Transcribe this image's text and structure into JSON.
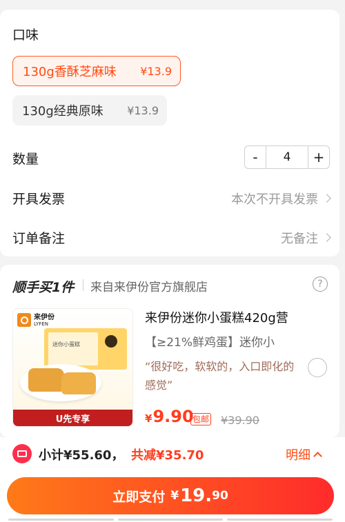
{
  "flavor": {
    "label": "口味",
    "options": [
      {
        "name": "130g香酥芝麻味",
        "price": "¥13.9",
        "selected": true
      },
      {
        "name": "130g经典原味",
        "price": "¥13.9",
        "selected": false
      }
    ]
  },
  "quantity": {
    "label": "数量",
    "minus": "-",
    "value": "4",
    "plus": "+"
  },
  "invoice": {
    "label": "开具发票",
    "value": "本次不开具发票"
  },
  "remark": {
    "label": "订单备注",
    "value": "无备注"
  },
  "addon": {
    "title": "顺手买1件",
    "from": "来自来伊份官方旗舰店",
    "help_icon": "?",
    "product": {
      "brand_cn": "来伊份",
      "brand_en": "LYFEN",
      "box_label": "迷你小蛋糕",
      "banner": "U先专享",
      "title": "来伊份迷你小蛋糕420g营",
      "subtitle": "【≥21%鲜鸡蛋】迷你小",
      "quote": "“很好吃，软软的，入口即化的感觉”",
      "price_symbol": "¥",
      "price": "9.90",
      "tag": "包邮",
      "old_price": "¥39.90"
    }
  },
  "footer": {
    "subtotal": "小计¥55.60，",
    "discount": "共减¥35.70",
    "detail": "明细",
    "pay_label": "立即支付",
    "pay_symbol": "¥",
    "pay_int": "19.",
    "pay_dec": "90"
  }
}
